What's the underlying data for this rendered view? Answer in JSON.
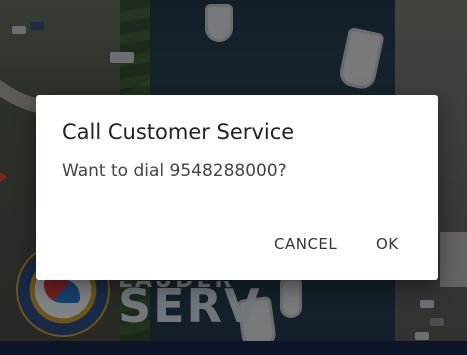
{
  "background": {
    "logo_word": "SERV",
    "logo_word_partial": "LAUDER"
  },
  "dialog": {
    "title": "Call Customer Service",
    "message": "Want to dial 9548288000?",
    "cancel_label": "CANCEL",
    "ok_label": "OK"
  },
  "colors": {
    "scrim": "#000000",
    "dialog_bg": "#ffffff",
    "title_text": "#222222",
    "message_text": "#444444",
    "button_text": "#333333",
    "marker_red": "#e04a3a",
    "bottom_bar": "#19294a"
  }
}
